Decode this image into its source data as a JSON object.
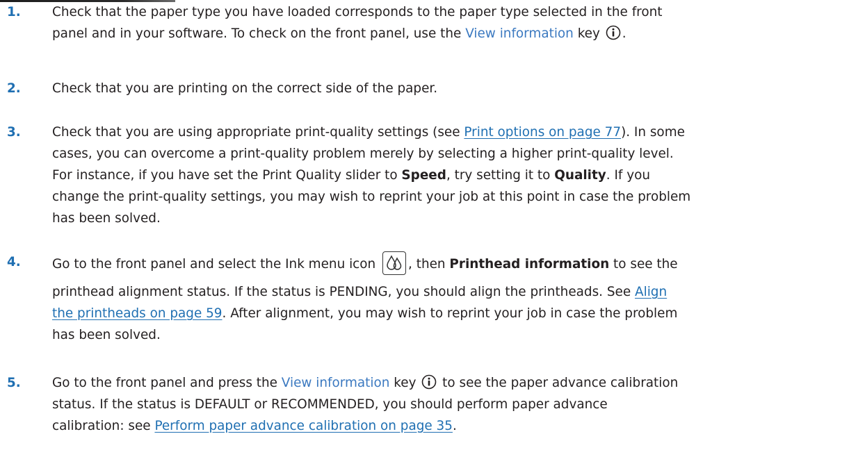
{
  "steps": [
    {
      "num": "1.",
      "line1": "Check that the paper type you have loaded corresponds to the paper type selected in the front",
      "line2_pre": "panel and in your software. To check on the front panel, use the ",
      "line2_key": "View information",
      "line2_post": " key",
      "line2_end": "."
    },
    {
      "num": "2.",
      "line1": "Check that you are printing on the correct side of the paper."
    },
    {
      "num": "3.",
      "line1_pre": "Check that you are using appropriate print-quality settings (see ",
      "line1_link": "Print options on page 77",
      "line1_post": "). In some",
      "line2": "cases, you can overcome a print-quality problem merely by selecting a higher print-quality level.",
      "line3_pre": "For instance, if you have set the Print Quality slider to ",
      "line3_b1": "Speed",
      "line3_mid": ", try setting it to ",
      "line3_b2": "Quality",
      "line3_post": ". If you",
      "line4": "change the print-quality settings, you may wish to reprint your job at this point in case the problem",
      "line5": "has been solved."
    },
    {
      "num": "4.",
      "line1_pre": "Go to the front panel and select the Ink menu icon ",
      "line1_mid": ", then ",
      "line1_b": "Printhead information",
      "line1_post": " to see the",
      "line2_pre": "printhead alignment status. If the status is PENDING, you should align the printheads. See ",
      "line2_link": "Align",
      "line3_link": "the printheads on page 59",
      "line3_post": ". After alignment, you may wish to reprint your job in case the problem",
      "line4": "has been solved."
    },
    {
      "num": "5.",
      "line1_pre": "Go to the front panel and press the ",
      "line1_key": "View information",
      "line1_post": " key",
      "line1_end": " to see the paper advance calibration",
      "line2": "status. If the status is DEFAULT or RECOMMENDED, you should perform paper advance",
      "line3_pre": "calibration: see ",
      "line3_link": "Perform paper advance calibration on page 35",
      "line3_post": "."
    }
  ],
  "colors": {
    "accent": "#1f6fb2",
    "text": "#231f20"
  },
  "icons": {
    "info": "info-circle-icon",
    "ink": "ink-drops-icon"
  }
}
